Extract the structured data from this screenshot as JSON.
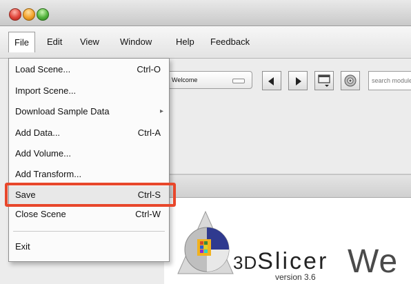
{
  "menubar": {
    "items": [
      "File",
      "Edit",
      "View",
      "Window",
      "Help",
      "Feedback"
    ]
  },
  "file_menu": {
    "items": [
      {
        "label": "Load Scene...",
        "shortcut": "Ctrl-O"
      },
      {
        "label": "Import Scene...",
        "shortcut": ""
      },
      {
        "label": "Download Sample Data",
        "shortcut": "",
        "submenu": true
      },
      {
        "label": "Add Data...",
        "shortcut": "Ctrl-A"
      },
      {
        "label": "Add Volume...",
        "shortcut": ""
      },
      {
        "label": "Add Transform...",
        "shortcut": ""
      },
      {
        "label": "Save",
        "shortcut": "Ctrl-S"
      },
      {
        "label": "Close Scene",
        "shortcut": "Ctrl-W"
      },
      {
        "label": "Exit",
        "shortcut": ""
      }
    ],
    "submenu_glyph": "▸"
  },
  "toolbar": {
    "module_select_value": "Welcome",
    "search_placeholder": "search module"
  },
  "branding": {
    "name_prefix": "3D",
    "name": "Slicer",
    "version": "version 3.6",
    "welcome_partial": "We"
  },
  "colors": {
    "callout": "#e8472b"
  }
}
